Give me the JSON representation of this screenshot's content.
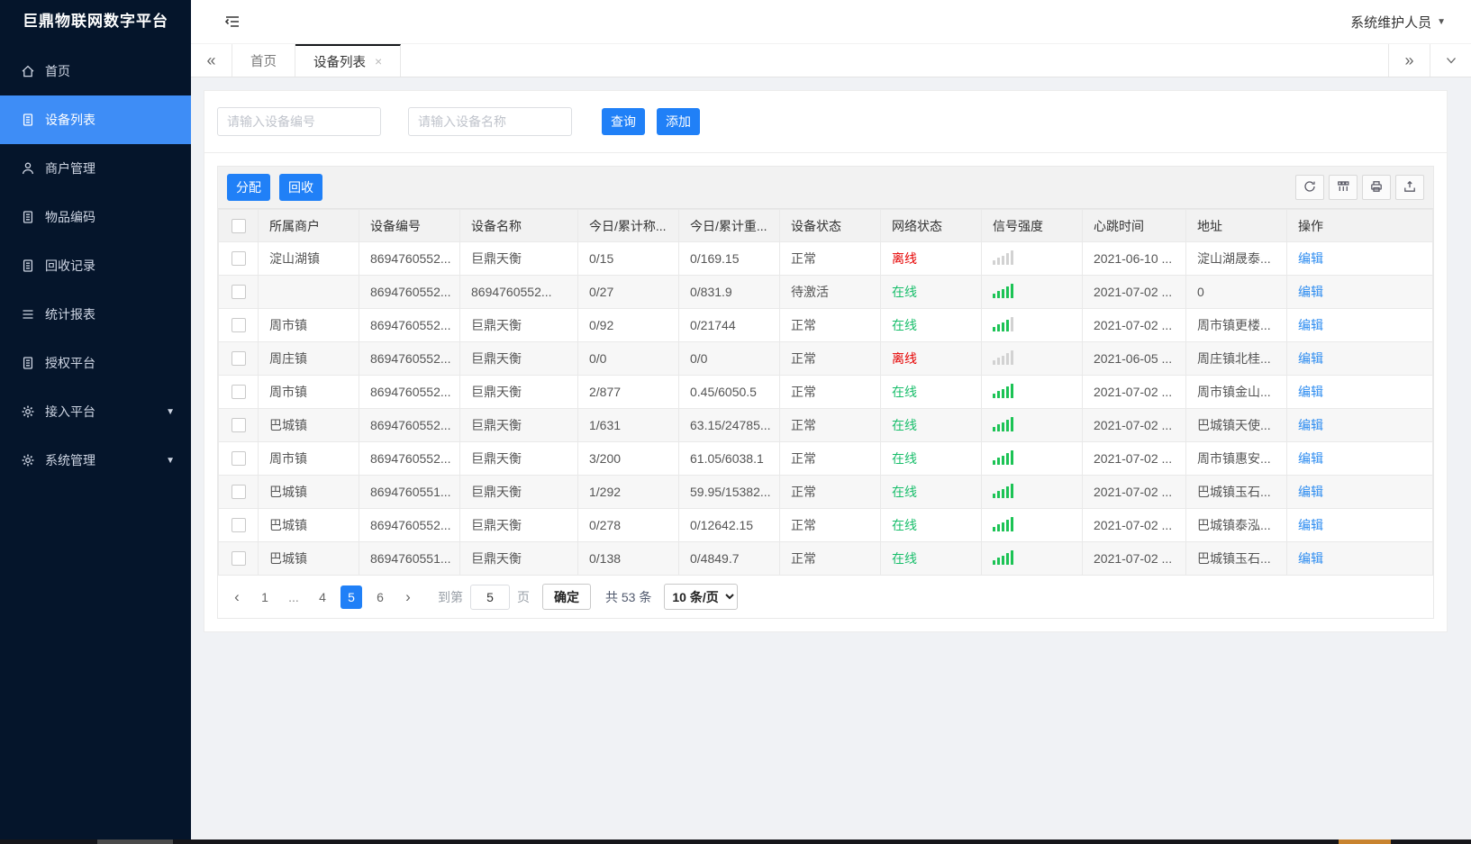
{
  "app": {
    "title": "巨鼎物联网数字平台",
    "user": "系统维护人员"
  },
  "sidebar": {
    "items": [
      {
        "label": "首页",
        "icon": "home",
        "active": false,
        "expandable": false
      },
      {
        "label": "设备列表",
        "icon": "doc",
        "active": true,
        "expandable": false
      },
      {
        "label": "商户管理",
        "icon": "user",
        "active": false,
        "expandable": false
      },
      {
        "label": "物品编码",
        "icon": "doc",
        "active": false,
        "expandable": false
      },
      {
        "label": "回收记录",
        "icon": "doc",
        "active": false,
        "expandable": false
      },
      {
        "label": "统计报表",
        "icon": "list",
        "active": false,
        "expandable": false
      },
      {
        "label": "授权平台",
        "icon": "doc",
        "active": false,
        "expandable": false
      },
      {
        "label": "接入平台",
        "icon": "gear",
        "active": false,
        "expandable": true
      },
      {
        "label": "系统管理",
        "icon": "gear",
        "active": false,
        "expandable": true
      }
    ]
  },
  "tabs": {
    "collapse_left": "«",
    "collapse_right": "»",
    "items": [
      {
        "label": "首页",
        "active": false,
        "closable": false
      },
      {
        "label": "设备列表",
        "active": true,
        "closable": true,
        "close_glyph": "×"
      }
    ]
  },
  "search": {
    "device_no_placeholder": "请输入设备编号",
    "device_name_placeholder": "请输入设备名称",
    "query_label": "查询",
    "add_label": "添加"
  },
  "toolbar": {
    "assign_label": "分配",
    "recycle_label": "回收",
    "icons": [
      "refresh",
      "columns",
      "print",
      "export"
    ]
  },
  "table": {
    "columns": [
      "所属商户",
      "设备编号",
      "设备名称",
      "今日/累计称...",
      "今日/累计重...",
      "设备状态",
      "网络状态",
      "信号强度",
      "心跳时间",
      "地址",
      "操作"
    ],
    "rows": [
      {
        "merchant": "淀山湖镇",
        "device_no": "8694760552...",
        "name": "巨鼎天衡",
        "today_count": "0/15",
        "today_weight": "0/169.15",
        "status": "正常",
        "network": "离线",
        "network_state": "offline",
        "signal": 0,
        "heartbeat": "2021-06-10 ...",
        "address": "淀山湖晟泰...",
        "action": "编辑"
      },
      {
        "merchant": "",
        "device_no": "8694760552...",
        "name": "8694760552...",
        "today_count": "0/27",
        "today_weight": "0/831.9",
        "status": "待激活",
        "network": "在线",
        "network_state": "online",
        "signal": 5,
        "heartbeat": "2021-07-02 ...",
        "address": "0",
        "action": "编辑"
      },
      {
        "merchant": "周市镇",
        "device_no": "8694760552...",
        "name": "巨鼎天衡",
        "today_count": "0/92",
        "today_weight": "0/21744",
        "status": "正常",
        "network": "在线",
        "network_state": "online",
        "signal": 4,
        "heartbeat": "2021-07-02 ...",
        "address": "周市镇更楼...",
        "action": "编辑"
      },
      {
        "merchant": "周庄镇",
        "device_no": "8694760552...",
        "name": "巨鼎天衡",
        "today_count": "0/0",
        "today_weight": "0/0",
        "status": "正常",
        "network": "离线",
        "network_state": "offline",
        "signal": 0,
        "heartbeat": "2021-06-05 ...",
        "address": "周庄镇北桂...",
        "action": "编辑"
      },
      {
        "merchant": "周市镇",
        "device_no": "8694760552...",
        "name": "巨鼎天衡",
        "today_count": "2/877",
        "today_weight": "0.45/6050.5",
        "status": "正常",
        "network": "在线",
        "network_state": "online",
        "signal": 5,
        "heartbeat": "2021-07-02 ...",
        "address": "周市镇金山...",
        "action": "编辑"
      },
      {
        "merchant": "巴城镇",
        "device_no": "8694760552...",
        "name": "巨鼎天衡",
        "today_count": "1/631",
        "today_weight": "63.15/24785...",
        "status": "正常",
        "network": "在线",
        "network_state": "online",
        "signal": 5,
        "heartbeat": "2021-07-02 ...",
        "address": "巴城镇天使...",
        "action": "编辑"
      },
      {
        "merchant": "周市镇",
        "device_no": "8694760552...",
        "name": "巨鼎天衡",
        "today_count": "3/200",
        "today_weight": "61.05/6038.1",
        "status": "正常",
        "network": "在线",
        "network_state": "online",
        "signal": 5,
        "heartbeat": "2021-07-02 ...",
        "address": "周市镇惠安...",
        "action": "编辑"
      },
      {
        "merchant": "巴城镇",
        "device_no": "8694760551...",
        "name": "巨鼎天衡",
        "today_count": "1/292",
        "today_weight": "59.95/15382...",
        "status": "正常",
        "network": "在线",
        "network_state": "online",
        "signal": 5,
        "heartbeat": "2021-07-02 ...",
        "address": "巴城镇玉石...",
        "action": "编辑"
      },
      {
        "merchant": "巴城镇",
        "device_no": "8694760552...",
        "name": "巨鼎天衡",
        "today_count": "0/278",
        "today_weight": "0/12642.15",
        "status": "正常",
        "network": "在线",
        "network_state": "online",
        "signal": 5,
        "heartbeat": "2021-07-02 ...",
        "address": "巴城镇泰泓...",
        "action": "编辑"
      },
      {
        "merchant": "巴城镇",
        "device_no": "8694760551...",
        "name": "巨鼎天衡",
        "today_count": "0/138",
        "today_weight": "0/4849.7",
        "status": "正常",
        "network": "在线",
        "network_state": "online",
        "signal": 5,
        "heartbeat": "2021-07-02 ...",
        "address": "巴城镇玉石...",
        "action": "编辑"
      }
    ]
  },
  "pagination": {
    "prev_glyph": "‹",
    "next_glyph": "›",
    "pages": [
      "1",
      "...",
      "4",
      "5",
      "6"
    ],
    "active_page": "5",
    "goto_label": "到第",
    "goto_value": "5",
    "page_unit": "页",
    "confirm_label": "确定",
    "total_label": "共 53 条",
    "page_size": "10 条/页"
  },
  "colors": {
    "accent": "#2080f7",
    "sidebar_bg": "#05152b",
    "sidebar_active": "#3e8df6",
    "online": "#19be6b",
    "offline": "#e60000",
    "signal_on": "#1cc355",
    "signal_off": "#d2d2d2",
    "link": "#2d8cf0"
  }
}
